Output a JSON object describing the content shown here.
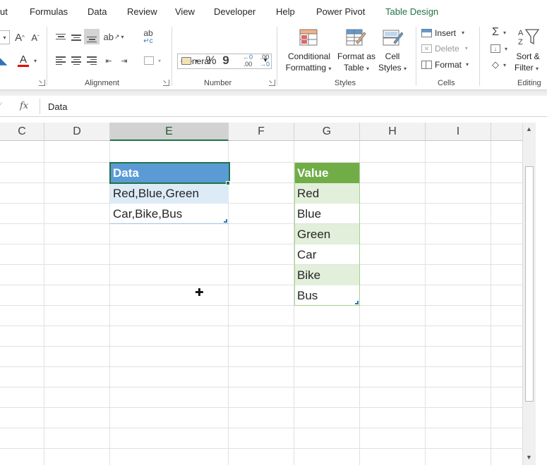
{
  "tabs": [
    {
      "label": "ut",
      "accent": false
    },
    {
      "label": "Formulas",
      "accent": false
    },
    {
      "label": "Data",
      "accent": false
    },
    {
      "label": "Review",
      "accent": false
    },
    {
      "label": "View",
      "accent": false
    },
    {
      "label": "Developer",
      "accent": false
    },
    {
      "label": "Help",
      "accent": false
    },
    {
      "label": "Power Pivot",
      "accent": false
    },
    {
      "label": "Table Design",
      "accent": true
    }
  ],
  "ribbon": {
    "font": {
      "grow_icon": "A^",
      "shrink_icon": "Aˇ",
      "font_color_icon": "A"
    },
    "groups": {
      "alignment": "Alignment",
      "number": "Number",
      "styles": "Styles",
      "cells": "Cells",
      "editing": "Editing"
    },
    "number_format": "General",
    "percent": "%",
    "comma": "9",
    "dec_inc": "←0 .00",
    "dec_dec": ".00 →0",
    "conditional_formatting": {
      "line1": "Conditional",
      "line2": "Formatting"
    },
    "format_as_table": {
      "line1": "Format as",
      "line2": "Table"
    },
    "cell_styles": {
      "line1": "Cell",
      "line2": "Styles"
    },
    "insert": "Insert",
    "delete": "Delete",
    "format": "Format",
    "sort_filter": {
      "line1": "Sort &",
      "line2": "Filter"
    },
    "sum_symbol": "Σ"
  },
  "formula_bar": {
    "fx": "fx",
    "value": "Data"
  },
  "columns": [
    "C",
    "D",
    "E",
    "F",
    "G",
    "H",
    "I"
  ],
  "active_column": "E",
  "table1": {
    "header": "Data",
    "rows": [
      "Red,Blue,Green",
      "Car,Bike,Bus"
    ]
  },
  "table2": {
    "header": "Value",
    "rows": [
      "Red",
      "Blue",
      "Green",
      "Car",
      "Bike",
      "Bus"
    ]
  },
  "colors": {
    "accent": "#217346",
    "table1_header": "#5b9bd5",
    "table1_band": "#ddebf7",
    "table2_header": "#70ad47",
    "table2_band": "#e2efda"
  }
}
